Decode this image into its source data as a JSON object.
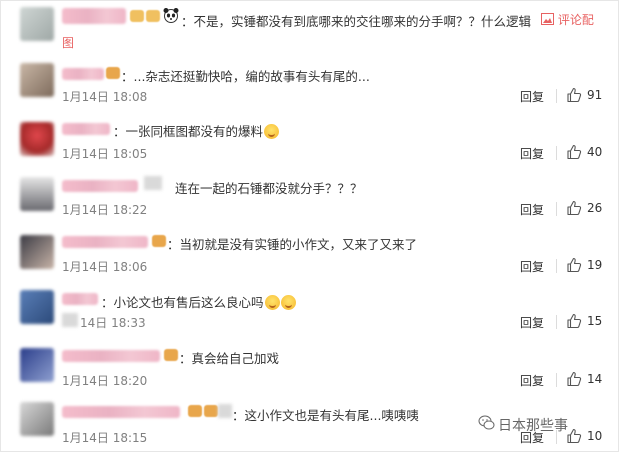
{
  "first": {
    "text": "：不是，实锤都没有到底哪来的交往哪来的分手啊？？什么逻辑",
    "action_label": "评论配",
    "action_label_cont": "图"
  },
  "comments": [
    {
      "text": "：...杂志还挺勤快哈，编的故事有头有尾的...",
      "date": "1月14日 18:08",
      "reply": "回复",
      "likes": "91"
    },
    {
      "text": "：一张同框图都没有的爆料",
      "date": "1月14日 18:05",
      "reply": "回复",
      "likes": "40"
    },
    {
      "text": "连在一起的石锤都没就分手？？？",
      "date": "1月14日 18:22",
      "reply": "回复",
      "likes": "26"
    },
    {
      "text": "：当初就是没有实锤的小作文，又来了又来了",
      "date": "1月14日 18:06",
      "reply": "回复",
      "likes": "19"
    },
    {
      "text": "：小论文也有售后这么良心吗",
      "date": "14日 18:33",
      "reply": "回复",
      "likes": "15"
    },
    {
      "text": "：真会给自己加戏",
      "date": "1月14日 18:20",
      "reply": "回复",
      "likes": "14"
    },
    {
      "text": "：这小作文也是有头有尾...咦咦咦",
      "date": "1月14日 18:15",
      "reply": "回复",
      "likes": "10"
    }
  ],
  "watermark": "日本那些事",
  "colors": {
    "link": "#e86262",
    "date": "#808080",
    "blurred_name": "#f0b8c8"
  },
  "icons": [
    "thumb-up-icon",
    "smile-emoji-icon",
    "panda-emoji-icon",
    "wechat-logo-icon"
  ]
}
